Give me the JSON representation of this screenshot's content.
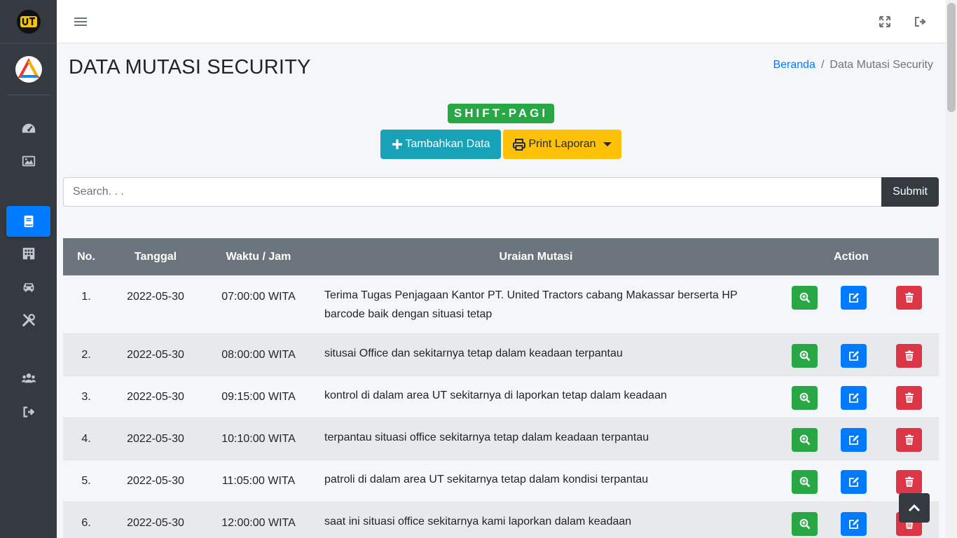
{
  "header": {
    "title": "DATA MUTASI SECURITY",
    "breadcrumb": {
      "home": "Beranda",
      "separator": "/",
      "current": "Data Mutasi Security"
    }
  },
  "shift": {
    "label": "SHIFT-PAGI"
  },
  "toolbar": {
    "add_label": "Tambahkan Data",
    "print_label": "Print Laporan"
  },
  "search": {
    "placeholder": "Search. . .",
    "value": "",
    "submit_label": "Submit"
  },
  "table": {
    "headers": {
      "no": "No.",
      "tanggal": "Tanggal",
      "waktu": "Waktu / Jam",
      "uraian": "Uraian Mutasi",
      "action": "Action"
    },
    "rows": [
      {
        "no": "1.",
        "tanggal": "2022-05-30",
        "waktu": "07:00:00 WITA",
        "uraian": "Terima Tugas Penjagaan Kantor PT. United Tractors cabang Makassar berserta HP barcode baik dengan situasi tetap"
      },
      {
        "no": "2.",
        "tanggal": "2022-05-30",
        "waktu": "08:00:00 WITA",
        "uraian": "situsai Office dan sekitarnya tetap dalam keadaan terpantau"
      },
      {
        "no": "3.",
        "tanggal": "2022-05-30",
        "waktu": "09:15:00 WITA",
        "uraian": "kontrol di dalam area UT sekitarnya di laporkan tetap dalam keadaan"
      },
      {
        "no": "4.",
        "tanggal": "2022-05-30",
        "waktu": "10:10:00 WITA",
        "uraian": "terpantau situasi office sekitarnya tetap dalam keadaan terpantau"
      },
      {
        "no": "5.",
        "tanggal": "2022-05-30",
        "waktu": "11:05:00 WITA",
        "uraian": "patroli di dalam area UT sekitarnya tetap dalam kondisi terpantau"
      },
      {
        "no": "6.",
        "tanggal": "2022-05-30",
        "waktu": "12:00:00 WITA",
        "uraian": "saat ini situasi office sekitarnya kami laporkan dalam keadaan"
      }
    ]
  },
  "sidebar": {
    "items": [
      {
        "icon": "dashboard-icon"
      },
      {
        "icon": "image-icon"
      },
      {
        "icon": "book-icon",
        "active": true
      },
      {
        "icon": "building-icon"
      },
      {
        "icon": "car-icon"
      },
      {
        "icon": "tools-icon"
      },
      {
        "icon": "users-icon"
      },
      {
        "icon": "sign-out-icon"
      }
    ]
  },
  "colors": {
    "sidebar": "#343a40",
    "primary": "#007bff",
    "success": "#28a745",
    "info": "#17a2b8",
    "warning": "#ffc107",
    "danger": "#dc3545",
    "table_header": "#6c757d"
  }
}
